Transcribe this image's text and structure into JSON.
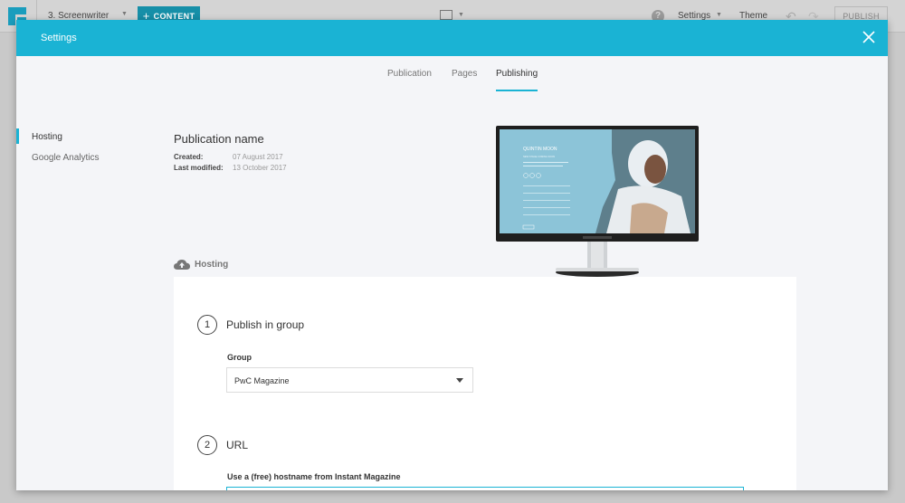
{
  "toolbar": {
    "project_name": "3. Screenwriter",
    "content_label": "CONTENT",
    "settings_label": "Settings",
    "theme_label": "Theme",
    "publish_label": "PUBLISH",
    "help_glyph": "?"
  },
  "modal": {
    "title": "Settings",
    "tabs": [
      {
        "label": "Publication",
        "active": false
      },
      {
        "label": "Pages",
        "active": false
      },
      {
        "label": "Publishing",
        "active": true
      }
    ],
    "sidebar": [
      {
        "label": "Hosting",
        "active": true
      },
      {
        "label": "Google Analytics",
        "active": false
      }
    ],
    "publication": {
      "name": "Publication name",
      "created_label": "Created:",
      "created_value": "07 August 2017",
      "modified_label": "Last modified:",
      "modified_value": "13 October 2017"
    },
    "preview": {
      "heading": "QUINTIN MOON",
      "subheading": "NEW STAGE COMING SOON"
    },
    "hosting_section_label": "Hosting",
    "steps": [
      {
        "number": "1",
        "title": "Publish in group"
      },
      {
        "number": "2",
        "title": "URL"
      }
    ],
    "group": {
      "label": "Group",
      "selected": "PwC Magazine"
    },
    "hostname_label": "Use a (free) hostname from Instant Magazine"
  },
  "colors": {
    "accent": "#1ab3d4",
    "content_button": "#168fa8",
    "modal_bg": "#f4f5f8"
  },
  "icons": [
    "logo-icon",
    "plus-icon",
    "device-icon",
    "help-icon",
    "undo-icon",
    "redo-icon",
    "close-icon",
    "cloud-upload-icon",
    "select-caret-icon"
  ]
}
